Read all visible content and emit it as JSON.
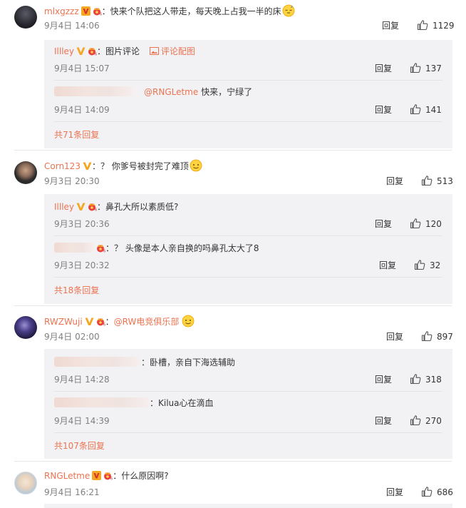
{
  "labels": {
    "reply": "回复"
  },
  "comments": [
    {
      "username": "mlxgzzz",
      "text": "：快来个队把这人带走，每天晚上占我一半的床",
      "time": "9月4日 14:06",
      "likes": "1129",
      "replies": [
        {
          "username": "Illley",
          "text": "：图片评论",
          "link": "评论配图",
          "time": "9月4日 15:07",
          "likes": "137"
        },
        {
          "username": "",
          "mention": "@RNGLetme",
          "text": " 快来，宁绿了",
          "time": "9月4日 14:09",
          "likes": "141"
        }
      ],
      "more": "共71条回复"
    },
    {
      "username": "Corn123",
      "text": "：？ 你爹号被封完了难顶",
      "time": "9月3日 20:30",
      "likes": "513",
      "replies": [
        {
          "username": "Illley",
          "text": "：鼻孔大所以素质低?",
          "time": "9月3日 20:36",
          "likes": "120"
        },
        {
          "username": "",
          "text": "：？ 头像是本人亲自换的吗鼻孔太大了8",
          "time": "9月3日 20:32",
          "likes": "32"
        }
      ],
      "more": "共18条回复"
    },
    {
      "username": "RWZWuji",
      "text": "：",
      "mention": "@RW电竞俱乐部",
      "time": "9月4日 02:00",
      "likes": "897",
      "replies": [
        {
          "username": "",
          "text": "：卧槽，亲自下海选辅助",
          "time": "9月4日 14:28",
          "likes": "318"
        },
        {
          "username": "",
          "text": "：Kilua心在滴血",
          "time": "9月4日 14:39",
          "likes": "270"
        }
      ],
      "more": "共107条回复"
    },
    {
      "username": "RNGLetme",
      "text": "：什么原因啊?",
      "time": "9月4日 16:21",
      "likes": "686"
    }
  ],
  "colors": {
    "accent": "#eb7350",
    "muted": "#808080",
    "subbg": "#f2f2f5"
  },
  "icons": [
    "thumbs-up-icon",
    "verified-v-icon",
    "crown-badge-icon",
    "image-icon",
    "emoji-icon"
  ]
}
